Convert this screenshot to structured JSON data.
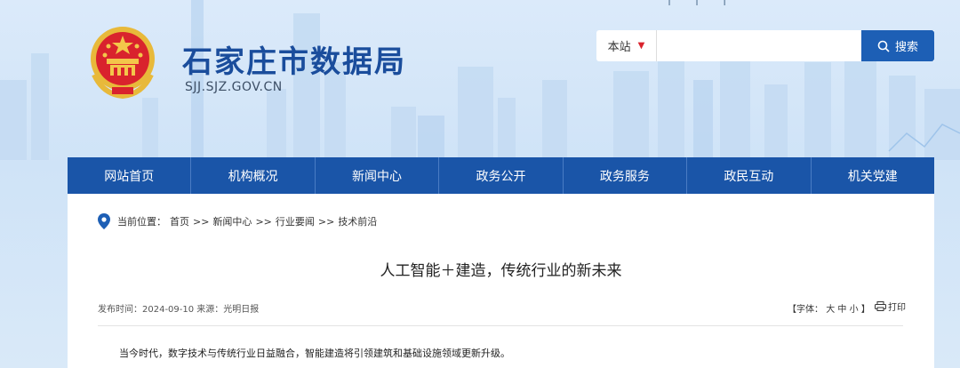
{
  "top_links": "——|——|——|——",
  "header": {
    "title": "石家庄市数据局",
    "domain": "SJJ.SJZ.GOV.CN"
  },
  "search": {
    "scope": "本站",
    "placeholder": "",
    "button_label": "搜索"
  },
  "nav": [
    {
      "label": "网站首页"
    },
    {
      "label": "机构概况"
    },
    {
      "label": "新闻中心"
    },
    {
      "label": "政务公开"
    },
    {
      "label": "政务服务"
    },
    {
      "label": "政民互动"
    },
    {
      "label": "机关党建"
    }
  ],
  "breadcrumb": {
    "prefix": "当前位置：",
    "items": [
      "首页",
      ">>",
      "新闻中心",
      ">>",
      "行业要闻",
      ">>",
      "技术前沿"
    ]
  },
  "article": {
    "title": "人工智能＋建造，传统行业的新未来",
    "meta": "发布时间：2024-09-10  来源：光明日报",
    "font_size_label": "【字体：",
    "font_large": "大",
    "font_medium": "中",
    "font_small": "小",
    "font_close": "】",
    "print_label": "打印",
    "first_paragraph": "当今时代，数字技术与传统行业日益融合，智能建造将引领建筑和基础设施领域更新升级。"
  },
  "colors": {
    "brand_blue": "#1a55a8",
    "title_blue": "#1a4d9c",
    "accent_red": "#d9232d"
  }
}
